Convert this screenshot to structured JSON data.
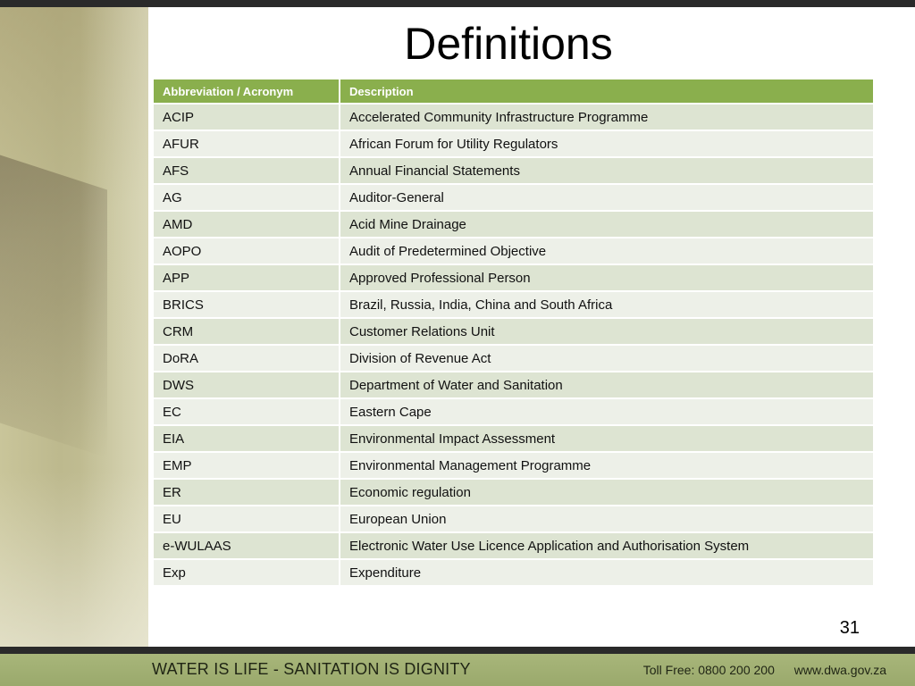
{
  "slide": {
    "title": "Definitions",
    "page_number": "31"
  },
  "table": {
    "headers": [
      "Abbreviation / Acronym",
      "Description"
    ],
    "rows": [
      [
        "ACIP",
        "Accelerated Community Infrastructure Programme"
      ],
      [
        "AFUR",
        "African Forum for Utility Regulators"
      ],
      [
        "AFS",
        "Annual Financial Statements"
      ],
      [
        "AG",
        "Auditor-General"
      ],
      [
        "AMD",
        "Acid Mine Drainage"
      ],
      [
        "AOPO",
        "Audit of Predetermined Objective"
      ],
      [
        "APP",
        "Approved Professional Person"
      ],
      [
        "BRICS",
        "Brazil, Russia, India, China and South Africa"
      ],
      [
        "CRM",
        "Customer Relations Unit"
      ],
      [
        "DoRA",
        "Division of Revenue Act"
      ],
      [
        "DWS",
        "Department of Water and Sanitation"
      ],
      [
        "EC",
        "Eastern Cape"
      ],
      [
        "EIA",
        "Environmental Impact Assessment"
      ],
      [
        "EMP",
        "Environmental Management Programme"
      ],
      [
        "ER",
        "Economic regulation"
      ],
      [
        "EU",
        "European Union"
      ],
      [
        "e-WULAAS",
        "Electronic Water Use Licence Application and Authorisation System"
      ],
      [
        "Exp",
        "Expenditure"
      ]
    ]
  },
  "footer": {
    "slogan": "WATER IS LIFE - SANITATION IS DIGNITY",
    "toll_free": "Toll Free: 0800 200 200",
    "website": "www.dwa.gov.za"
  },
  "colors": {
    "header_green": "#8aaf4d",
    "row_odd": "#dde4d2",
    "row_even": "#edf0e8",
    "footer_green": "#a8b67a",
    "dark_bar": "#2a2a2a"
  }
}
